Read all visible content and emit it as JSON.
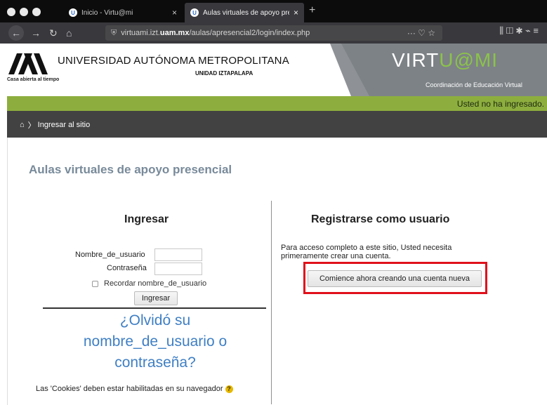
{
  "browser": {
    "tabs": [
      {
        "label": "Inicio - Virtu@mi",
        "close": "×"
      },
      {
        "label": "Aulas virtuales de apoyo prese",
        "close": "×"
      }
    ],
    "new_tab": "+",
    "url_prefix": "virtuami.izt.",
    "url_domain": "uam.mx",
    "url_path": "/aulas/apresencial2/login/index.php",
    "url_actions": "··· ♡ ☆",
    "toolbar_icons": "⫼  ◫  ✱  ⌁  ≡"
  },
  "header": {
    "university": "UNIVERSIDAD AUTÓNOMA METROPOLITANA",
    "unit": "UNIDAD IZTAPALAPA",
    "tagline": "Casa abierta al tiempo",
    "brand_a": "VIRT",
    "brand_b": "U@MI",
    "subtitle": "Coordinación de Educación Virtual",
    "login_status": "Usted no ha ingresado."
  },
  "breadcrumb": {
    "home_icon": "⌂",
    "separator": "〉",
    "item": "Ingresar al sitio"
  },
  "page": {
    "title": "Aulas virtuales de apoyo presencial"
  },
  "login": {
    "heading": "Ingresar",
    "username_label": "Nombre_de_usuario",
    "username_value": "",
    "password_label": "Contraseña",
    "password_value": "",
    "remember_label": "Recordar nombre_de_usuario",
    "submit_label": "Ingresar",
    "forgot_line1": "¿Olvidó su",
    "forgot_line2": "nombre_de_usuario o",
    "forgot_line3": "contraseña?",
    "cookies_text": "Las 'Cookies' deben estar habilitadas en su navegador",
    "help_icon": "?"
  },
  "register": {
    "heading": "Registrarse como usuario",
    "text": "Para acceso completo a este sitio, Usted necesita primeramente crear una cuenta.",
    "button_label": "Comience ahora creando una cuenta nueva"
  },
  "colors": {
    "green_bar": "#8dae3e",
    "dark_bar": "#424242",
    "link": "#3f7fc4",
    "highlight": "#e0101b"
  }
}
